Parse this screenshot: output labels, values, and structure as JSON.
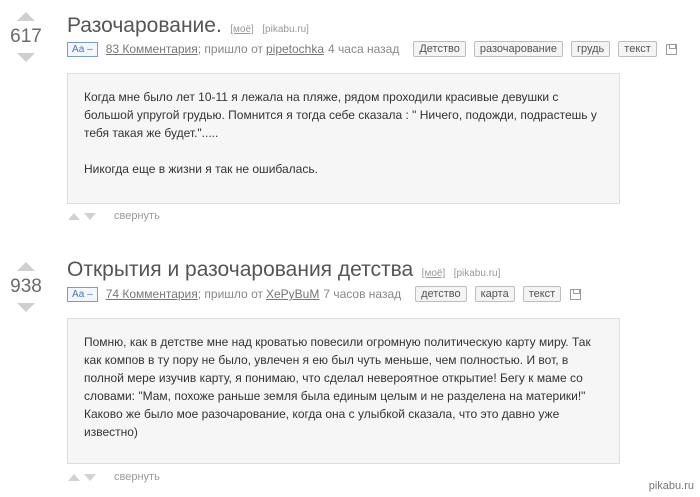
{
  "posts": [
    {
      "rating": "617",
      "title": "Разочарование.",
      "mine_label": "[моё]",
      "source": "[pikabu.ru]",
      "font_toggle": "Аа –",
      "comments": "83 Комментария",
      "from_text": "; пришло от",
      "author": "pipetochka",
      "time": "4 часа назад",
      "tags": [
        "Детство",
        "разочарование",
        "грудь",
        "текст"
      ],
      "body": [
        "Когда мне было лет 10-11 я лежала на пляже, рядом проходили красивые девушки с большой упругой грудью. Помнится я тогда себе сказала : \" Ничего, подожди, подрастешь у тебя такая же будет.\".....",
        "",
        "Никогда еще в жизни я так не ошибалась."
      ],
      "collapse": "свернуть"
    },
    {
      "rating": "938",
      "title": "Открытия и разочарования детства",
      "mine_label": "[моё]",
      "source": "[pikabu.ru]",
      "font_toggle": "Аа –",
      "comments": "74 Комментария",
      "from_text": "; пришло от",
      "author": "XePyBuM",
      "time": "7 часов назад",
      "tags": [
        "детство",
        "карта",
        "текст"
      ],
      "body": [
        "Помню, как в детстве мне над кроватью повесили огромную политическую карту миру. Так как компов в ту пору не было, увлечен я ею был чуть меньше, чем полностью. И вот, в полной мере изучив карту, я понимаю, что сделал невероятное открытие! Бегу к маме со словами: \"Мам, похоже раньше земля была единым целым и не разделена на материки!\"",
        "Каково же было мое разочарование, когда она с улыбкой сказала, что это давно уже известно)"
      ],
      "collapse": "свернуть"
    }
  ],
  "watermark": "pikabu.ru"
}
